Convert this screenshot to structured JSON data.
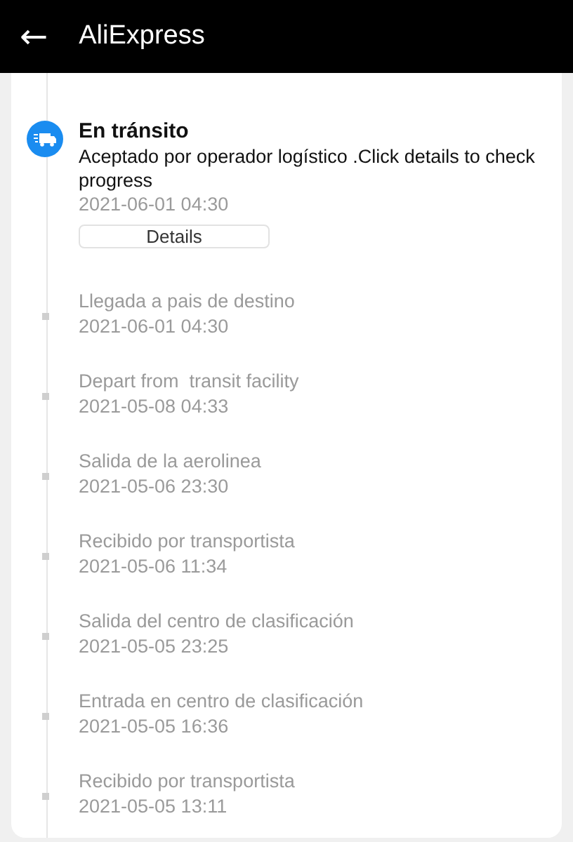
{
  "header": {
    "back": "←",
    "title": "AliExpress"
  },
  "current_event": {
    "title": "En tránsito",
    "description": "Aceptado por operador logístico .Click details to check progress",
    "time": "2021-06-01 04:30",
    "button": "Details"
  },
  "events": [
    {
      "title": "Llegada a pais de destino",
      "time": "2021-06-01 04:30"
    },
    {
      "title": "Depart from  transit facility",
      "time": "2021-05-08 04:33"
    },
    {
      "title": "Salida de la aerolinea",
      "time": "2021-05-06 23:30"
    },
    {
      "title": "Recibido por transportista",
      "time": "2021-05-06 11:34"
    },
    {
      "title": "Salida del centro de clasificación",
      "time": "2021-05-05 23:25"
    },
    {
      "title": "Entrada en centro de clasificación",
      "time": "2021-05-05 16:36"
    },
    {
      "title": "Recibido por transportista",
      "time": "2021-05-05 13:11"
    }
  ]
}
